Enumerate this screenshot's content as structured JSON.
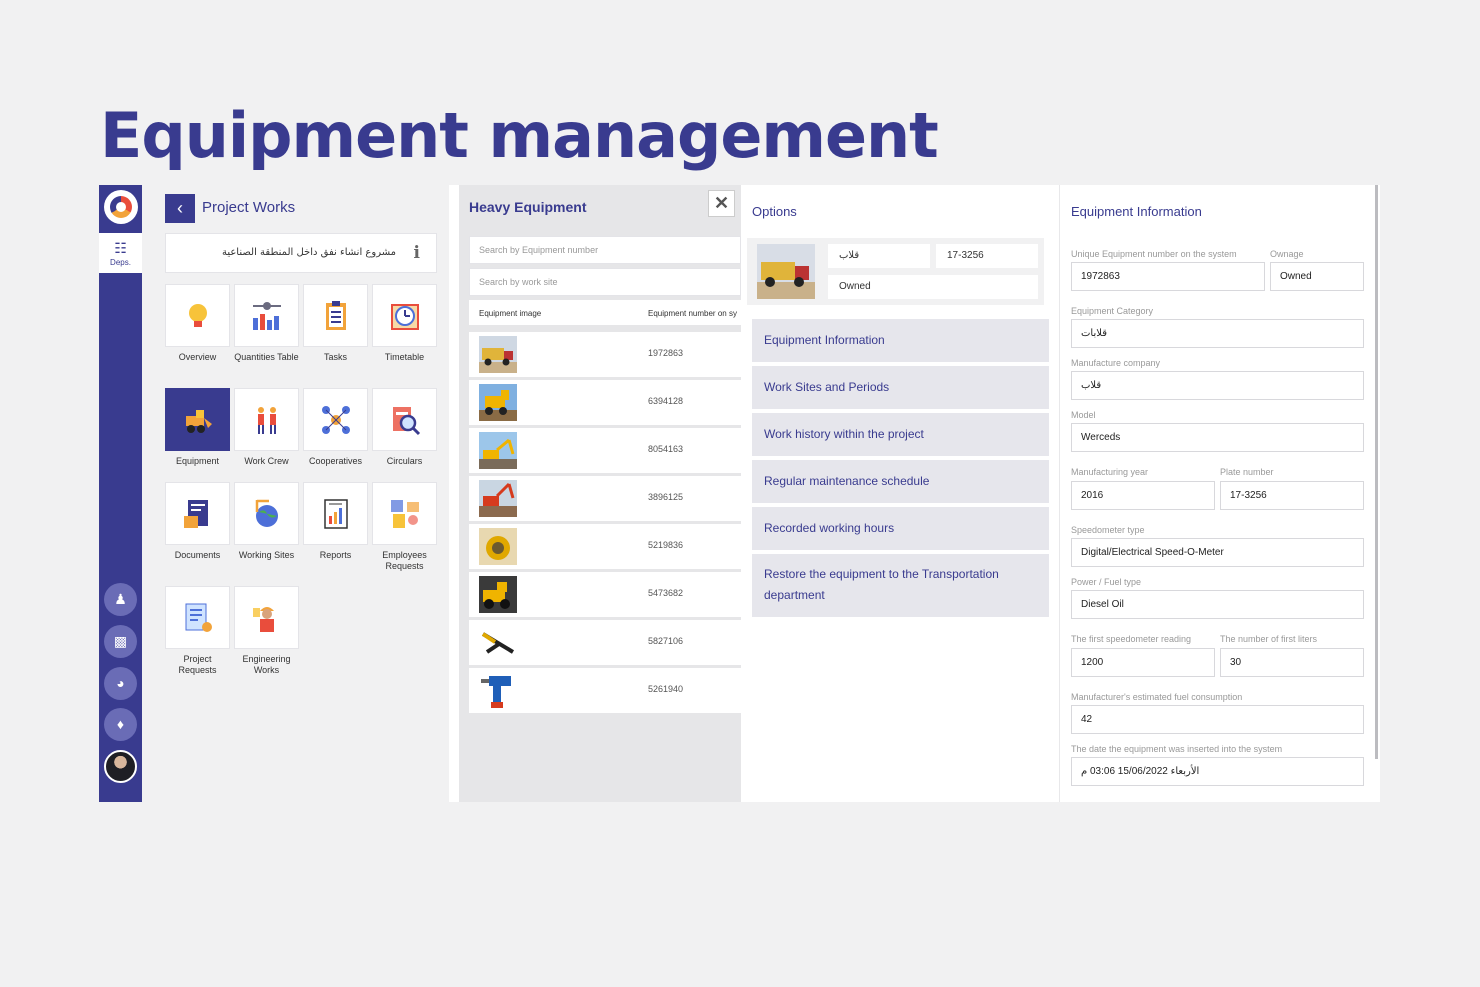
{
  "page": {
    "headline": "Equipment management"
  },
  "rail": {
    "tab_label": "Deps."
  },
  "project": {
    "title": "Project Works",
    "name": "مشروع انشاء نفق داخل المنطقة الصناعية",
    "tiles": [
      {
        "label": "Overview",
        "icon": "lightbulb-icon"
      },
      {
        "label": "Quantities Table",
        "icon": "quantities-chart-icon"
      },
      {
        "label": "Tasks",
        "icon": "clipboard-icon"
      },
      {
        "label": "Timetable",
        "icon": "clock-calendar-icon"
      },
      {
        "label": "Equipment",
        "icon": "loader-vehicle-icon"
      },
      {
        "label": "Work Crew",
        "icon": "workers-icon"
      },
      {
        "label": "Cooperatives",
        "icon": "network-icon"
      },
      {
        "label": "Circulars",
        "icon": "magnifier-document-icon"
      },
      {
        "label": "Documents",
        "icon": "document-folder-icon"
      },
      {
        "label": "Working Sites",
        "icon": "globe-crane-icon"
      },
      {
        "label": "Reports",
        "icon": "report-icon"
      },
      {
        "label": "Employees Requests",
        "icon": "employee-request-icon"
      },
      {
        "label": "Project Requests",
        "icon": "project-request-icon"
      },
      {
        "label": "Engineering Works",
        "icon": "engineer-icon"
      }
    ]
  },
  "equipment_list": {
    "title": "Heavy Equipment",
    "search_number_placeholder": "Search by Equipment number",
    "search_site_placeholder": "Search by work site",
    "col_image": "Equipment image",
    "col_number": "Equipment number on sy",
    "rows": [
      {
        "number": "1972863"
      },
      {
        "number": "6394128"
      },
      {
        "number": "8054163"
      },
      {
        "number": "3896125"
      },
      {
        "number": "5219836"
      },
      {
        "number": "5473682"
      },
      {
        "number": "5827106"
      },
      {
        "number": "5261940"
      }
    ]
  },
  "options": {
    "title": "Options",
    "card": {
      "category": "قلاب",
      "plate": "17-3256",
      "ownage": "Owned"
    },
    "items": [
      "Equipment Information",
      "Work Sites and Periods",
      "Work history within the project",
      "Regular maintenance schedule",
      "Recorded working hours",
      "Restore the equipment to the Transportation department"
    ]
  },
  "info": {
    "title": "Equipment Information",
    "unique_label": "Unique Equipment number on the system",
    "unique_value": "1972863",
    "ownage_label": "Ownage",
    "ownage_value": "Owned",
    "category_label": "Equipment Category",
    "category_value": "قلابات",
    "manufacturer_label": "Manufacture company",
    "manufacturer_value": "قلاب",
    "model_label": "Model",
    "model_value": "Werceds",
    "year_label": "Manufacturing year",
    "year_value": "2016",
    "plate_label": "Plate number",
    "plate_value": "17-3256",
    "speedometer_label": "Speedometer type",
    "speedometer_value": "Digital/Electrical Speed-O-Meter",
    "fuel_label": "Power / Fuel type",
    "fuel_value": "Diesel Oil",
    "first_reading_label": "The first speedometer reading",
    "first_reading_value": "1200",
    "first_liters_label": "The number of first liters",
    "first_liters_value": "30",
    "consumption_label": "Manufacturer's estimated fuel consumption",
    "consumption_value": "42",
    "inserted_label": "The date the equipment was inserted into the system",
    "inserted_value": "الأربعاء 15/06/2022 03:06 م"
  },
  "colors": {
    "brand": "#393b8f",
    "accent_red": "#e94d3c",
    "accent_orange": "#f2a33a",
    "background": "#f1f1f2"
  }
}
